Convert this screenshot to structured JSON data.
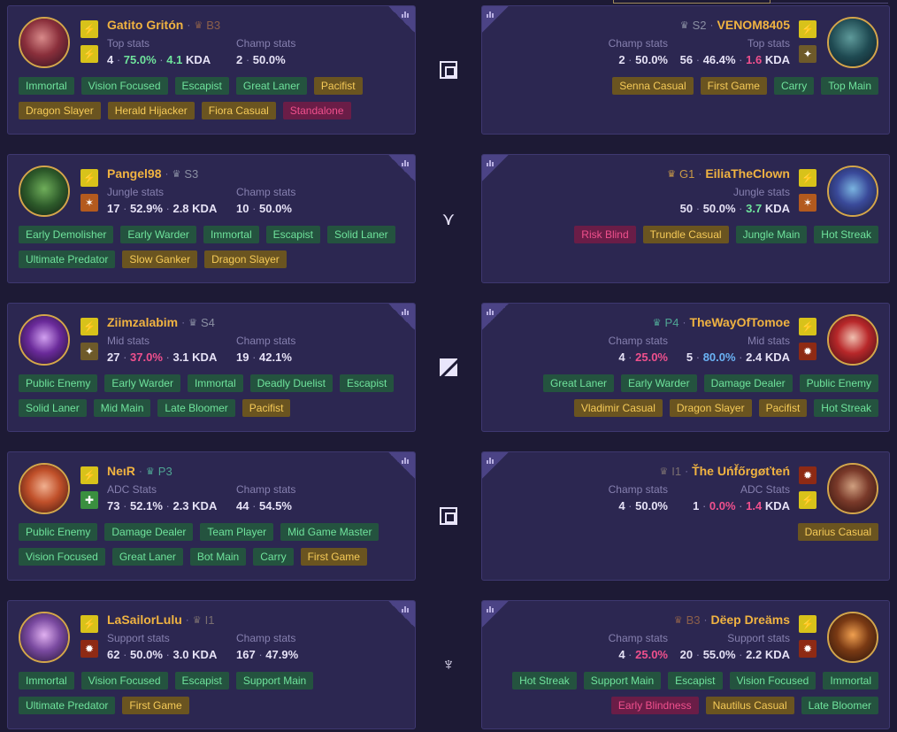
{
  "colors": {
    "green": "#6fe39c",
    "pink": "#f0508d",
    "blue": "#6ab3f5",
    "gold": "#f0b341"
  },
  "matchups": [
    {
      "lane_icon": "top-lane-icon",
      "left": {
        "name": "Gatito Gritón",
        "rank_icon": "bronze-emblem-icon",
        "rank": "B3",
        "spells": [
          "flash-spell-icon",
          "flash-spell-icon"
        ],
        "role_stats": {
          "label": "Top stats",
          "games": "4",
          "winrate": "75.0%",
          "winrate_color": "green",
          "kda": "4.1",
          "kda_color": "green",
          "kda_label": "KDA"
        },
        "champ_stats": {
          "label": "Champ stats",
          "games": "2",
          "winrate": "50.0%",
          "winrate_color": "white"
        },
        "tags": [
          {
            "text": "Immortal",
            "color": "green"
          },
          {
            "text": "Vision Focused",
            "color": "green"
          },
          {
            "text": "Escapist",
            "color": "green"
          },
          {
            "text": "Great Laner",
            "color": "green"
          },
          {
            "text": "Pacifist",
            "color": "gold"
          },
          {
            "text": "Dragon Slayer",
            "color": "gold"
          },
          {
            "text": "Herald Hijacker",
            "color": "gold"
          },
          {
            "text": "Fiora Casual",
            "color": "gold"
          },
          {
            "text": "Standalone",
            "color": "red"
          }
        ]
      },
      "right": {
        "name": "VENOM8405",
        "rank_icon": "silver-emblem-icon",
        "rank": "S2",
        "spells": [
          "flash-spell-icon",
          "teleport-spell-icon"
        ],
        "champ_stats": {
          "label": "Champ stats",
          "games": "2",
          "winrate": "50.0%",
          "winrate_color": "white"
        },
        "role_stats": {
          "label": "Top stats",
          "games": "56",
          "winrate": "46.4%",
          "winrate_color": "white",
          "kda": "1.6",
          "kda_color": "pink",
          "kda_label": "KDA"
        },
        "tags": [
          {
            "text": "Senna Casual",
            "color": "gold"
          },
          {
            "text": "First Game",
            "color": "gold"
          },
          {
            "text": "Carry",
            "color": "green"
          },
          {
            "text": "Top Main",
            "color": "green"
          }
        ]
      }
    },
    {
      "lane_icon": "jungle-lane-icon",
      "left": {
        "name": "Pangel98",
        "rank_icon": "silver-emblem-icon",
        "rank": "S3",
        "spells": [
          "flash-spell-icon",
          "smite-spell-icon"
        ],
        "role_stats": {
          "label": "Jungle stats",
          "games": "17",
          "winrate": "52.9%",
          "winrate_color": "white",
          "kda": "2.8",
          "kda_color": "white",
          "kda_label": "KDA"
        },
        "champ_stats": {
          "label": "Champ stats",
          "games": "10",
          "winrate": "50.0%",
          "winrate_color": "white"
        },
        "tags": [
          {
            "text": "Early Demolisher",
            "color": "green"
          },
          {
            "text": "Early Warder",
            "color": "green"
          },
          {
            "text": "Immortal",
            "color": "green"
          },
          {
            "text": "Escapist",
            "color": "green"
          },
          {
            "text": "Solid Laner",
            "color": "green"
          },
          {
            "text": "Ultimate Predator",
            "color": "green"
          },
          {
            "text": "Slow Ganker",
            "color": "gold"
          },
          {
            "text": "Dragon Slayer",
            "color": "gold"
          }
        ]
      },
      "right": {
        "name": "EiliaTheClown",
        "rank_icon": "gold-emblem-icon",
        "rank": "G1",
        "spells": [
          "flash-spell-icon",
          "smite-spell-icon"
        ],
        "champ_stats": {
          "label": "",
          "games": "",
          "winrate": "",
          "winrate_color": "white"
        },
        "role_stats": {
          "label": "Jungle stats",
          "games": "50",
          "winrate": "50.0%",
          "winrate_color": "white",
          "kda": "3.7",
          "kda_color": "green",
          "kda_label": "KDA"
        },
        "tags": [
          {
            "text": "Risk Blind",
            "color": "red"
          },
          {
            "text": "Trundle Casual",
            "color": "gold"
          },
          {
            "text": "Jungle Main",
            "color": "green"
          },
          {
            "text": "Hot Streak",
            "color": "green"
          }
        ]
      }
    },
    {
      "lane_icon": "mid-lane-icon",
      "left": {
        "name": "Ziimzalabim",
        "rank_icon": "silver-emblem-icon",
        "rank": "S4",
        "spells": [
          "flash-spell-icon",
          "teleport-spell-icon"
        ],
        "role_stats": {
          "label": "Mid stats",
          "games": "27",
          "winrate": "37.0%",
          "winrate_color": "pink",
          "kda": "3.1",
          "kda_color": "white",
          "kda_label": "KDA"
        },
        "champ_stats": {
          "label": "Champ stats",
          "games": "19",
          "winrate": "42.1%",
          "winrate_color": "white"
        },
        "tags": [
          {
            "text": "Public Enemy",
            "color": "green"
          },
          {
            "text": "Early Warder",
            "color": "green"
          },
          {
            "text": "Immortal",
            "color": "green"
          },
          {
            "text": "Deadly Duelist",
            "color": "green"
          },
          {
            "text": "Escapist",
            "color": "green"
          },
          {
            "text": "Solid Laner",
            "color": "green"
          },
          {
            "text": "Mid Main",
            "color": "green"
          },
          {
            "text": "Late Bloomer",
            "color": "green"
          },
          {
            "text": "Pacifist",
            "color": "gold"
          }
        ]
      },
      "right": {
        "name": "TheWayOfTomoe",
        "rank_icon": "platinum-emblem-icon",
        "rank": "P4",
        "spells": [
          "flash-spell-icon",
          "ignite-spell-icon"
        ],
        "champ_stats": {
          "label": "Champ stats",
          "games": "4",
          "winrate": "25.0%",
          "winrate_color": "pink"
        },
        "role_stats": {
          "label": "Mid stats",
          "games": "5",
          "winrate": "80.0%",
          "winrate_color": "blue",
          "kda": "2.4",
          "kda_color": "white",
          "kda_label": "KDA"
        },
        "tags": [
          {
            "text": "Great Laner",
            "color": "green"
          },
          {
            "text": "Early Warder",
            "color": "green"
          },
          {
            "text": "Damage Dealer",
            "color": "green"
          },
          {
            "text": "Public Enemy",
            "color": "green"
          },
          {
            "text": "Vladimir Casual",
            "color": "gold"
          },
          {
            "text": "Dragon Slayer",
            "color": "gold"
          },
          {
            "text": "Pacifist",
            "color": "gold"
          },
          {
            "text": "Hot Streak",
            "color": "green"
          }
        ]
      }
    },
    {
      "lane_icon": "bot-lane-icon",
      "left": {
        "name": "NeιR",
        "rank_icon": "platinum-emblem-icon",
        "rank": "P3",
        "spells": [
          "flash-spell-icon",
          "heal-spell-icon"
        ],
        "role_stats": {
          "label": "ADC Stats",
          "games": "73",
          "winrate": "52.1%",
          "winrate_color": "white",
          "kda": "2.3",
          "kda_color": "white",
          "kda_label": "KDA"
        },
        "champ_stats": {
          "label": "Champ stats",
          "games": "44",
          "winrate": "54.5%",
          "winrate_color": "white"
        },
        "tags": [
          {
            "text": "Public Enemy",
            "color": "green"
          },
          {
            "text": "Damage Dealer",
            "color": "green"
          },
          {
            "text": "Team Player",
            "color": "green"
          },
          {
            "text": "Mid Game Master",
            "color": "green"
          },
          {
            "text": "Vision Focused",
            "color": "green"
          },
          {
            "text": "Great Laner",
            "color": "green"
          },
          {
            "text": "Bot Main",
            "color": "green"
          },
          {
            "text": "Carry",
            "color": "green"
          },
          {
            "text": "First Game",
            "color": "gold"
          }
        ]
      },
      "right": {
        "name": "Ť̌he Uńf̌őrgøťteń",
        "rank_icon": "iron-emblem-icon",
        "rank": "I1",
        "spells": [
          "ignite-spell-icon",
          "flash-spell-icon"
        ],
        "champ_stats": {
          "label": "Champ stats",
          "games": "4",
          "winrate": "50.0%",
          "winrate_color": "white"
        },
        "role_stats": {
          "label": "ADC Stats",
          "games": "1",
          "winrate": "0.0%",
          "winrate_color": "pink",
          "kda": "1.4",
          "kda_color": "pink",
          "kda_label": "KDA"
        },
        "tags": [
          {
            "text": "Darius Casual",
            "color": "gold"
          }
        ]
      }
    },
    {
      "lane_icon": "support-lane-icon",
      "left": {
        "name": "LaSailorLulu",
        "rank_icon": "iron-emblem-icon",
        "rank": "I1",
        "spells": [
          "flash-spell-icon",
          "ignite-spell-icon"
        ],
        "role_stats": {
          "label": "Support stats",
          "games": "62",
          "winrate": "50.0%",
          "winrate_color": "white",
          "kda": "3.0",
          "kda_color": "white",
          "kda_label": "KDA"
        },
        "champ_stats": {
          "label": "Champ stats",
          "games": "167",
          "winrate": "47.9%",
          "winrate_color": "white"
        },
        "tags": [
          {
            "text": "Immortal",
            "color": "green"
          },
          {
            "text": "Vision Focused",
            "color": "green"
          },
          {
            "text": "Escapist",
            "color": "green"
          },
          {
            "text": "Support Main",
            "color": "green"
          },
          {
            "text": "Ultimate Predator",
            "color": "green"
          },
          {
            "text": "First Game",
            "color": "gold"
          }
        ]
      },
      "right": {
        "name": "Dëep Dreäms",
        "rank_icon": "bronze-emblem-icon",
        "rank": "B3",
        "spells": [
          "flash-spell-icon",
          "ignite-spell-icon"
        ],
        "champ_stats": {
          "label": "Champ stats",
          "games": "4",
          "winrate": "25.0%",
          "winrate_color": "pink"
        },
        "role_stats": {
          "label": "Support stats",
          "games": "20",
          "winrate": "55.0%",
          "winrate_color": "white",
          "kda": "2.2",
          "kda_color": "white",
          "kda_label": "KDA"
        },
        "tags": [
          {
            "text": "Hot Streak",
            "color": "green"
          },
          {
            "text": "Support Main",
            "color": "green"
          },
          {
            "text": "Escapist",
            "color": "green"
          },
          {
            "text": "Vision Focused",
            "color": "green"
          },
          {
            "text": "Immortal",
            "color": "green"
          },
          {
            "text": "Early Blindness",
            "color": "red"
          },
          {
            "text": "Nautilus Casual",
            "color": "gold"
          },
          {
            "text": "Late Bloomer",
            "color": "green"
          }
        ]
      }
    }
  ]
}
